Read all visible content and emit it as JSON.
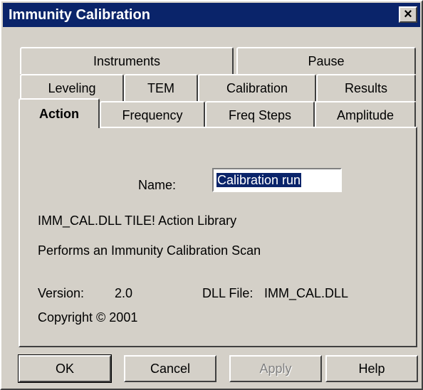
{
  "window": {
    "title": "Immunity Calibration",
    "close_glyph": "×"
  },
  "tabs": {
    "row1": [
      "Instruments",
      "Pause"
    ],
    "row2": [
      "Leveling",
      "TEM",
      "Calibration",
      "Results"
    ],
    "row3": [
      "Action",
      "Frequency",
      "Freq Steps",
      "Amplitude"
    ],
    "active": "Action"
  },
  "action_panel": {
    "name_label": "Name:",
    "name_value": "Calibration run",
    "library_line": "IMM_CAL.DLL TILE! Action Library",
    "description": "Performs an Immunity Calibration Scan",
    "version_label": "Version:",
    "version_value": "2.0",
    "dll_file_label": "DLL File:",
    "dll_file_value": "IMM_CAL.DLL",
    "copyright": "Copyright © 2001"
  },
  "buttons": {
    "ok": "OK",
    "cancel": "Cancel",
    "apply": "Apply",
    "help": "Help",
    "apply_enabled": false
  },
  "colors": {
    "titlebar": "#0a246a",
    "face": "#d4d0c8",
    "selection": "#0a246a"
  }
}
